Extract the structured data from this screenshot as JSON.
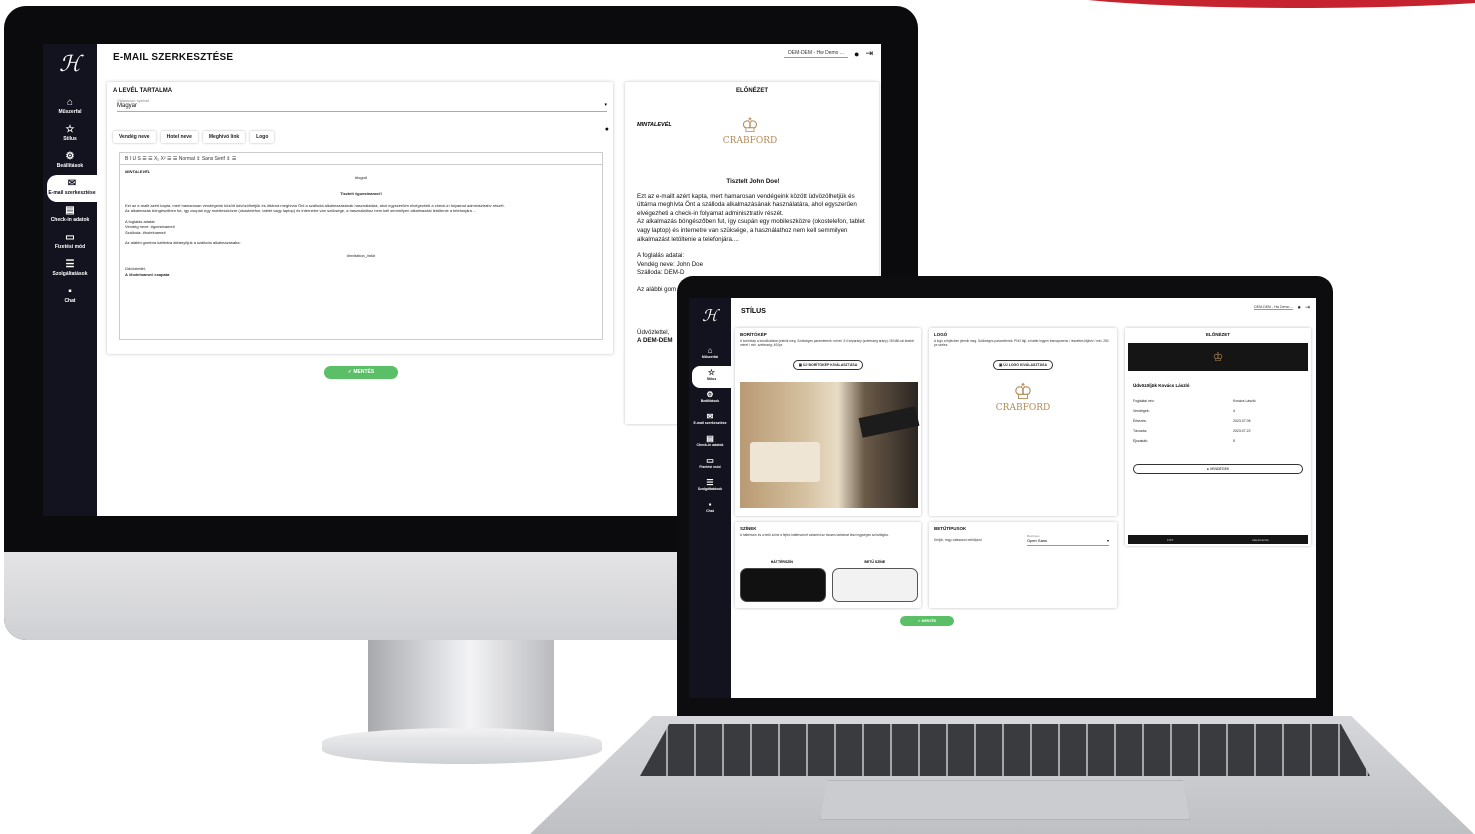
{
  "desktop": {
    "sidebar": {
      "logo": "ℋ",
      "items": [
        {
          "icon": "home-icon",
          "glyph": "⌂",
          "label": "Műszerfal"
        },
        {
          "icon": "star-icon",
          "glyph": "☆",
          "label": "Stílus"
        },
        {
          "icon": "gear-icon",
          "glyph": "⚙",
          "label": "Beállítások"
        },
        {
          "icon": "mail-icon",
          "glyph": "✉",
          "label": "E-mail szerkesztése"
        },
        {
          "icon": "document-icon",
          "glyph": "▤",
          "label": "Check-in adatok"
        },
        {
          "icon": "card-icon",
          "glyph": "▭",
          "label": "Fizetési mód"
        },
        {
          "icon": "list-icon",
          "glyph": "☰",
          "label": "Szolgáltatások"
        },
        {
          "icon": "chat-icon",
          "glyph": "▪",
          "label": "Chat"
        }
      ]
    },
    "page_title": "E-MAIL SZERKESZTÉSE",
    "hotel_select": "DEM-DEM - Hw Demo ...",
    "content_card": {
      "title": "A LEVÉL TARTALMA",
      "lang_label": "Válasszon nyelvet",
      "lang_value": "Magyar",
      "chips": [
        "Vendég neve",
        "Hotel neve",
        "Meghívó link",
        "Logo"
      ],
      "toolbar": "B  I  U  S    ☰  ☰    X₂  X²    ☰  ☰     Normal  ⇕     Sans Serif  ⇕     ☰",
      "body": {
        "l1": "MINTALEVÉL",
        "l2": "#logo#",
        "l3": "Tisztelt #guestname#!",
        "l4": "Ezt az e-mailt azért kapta, mert hamarosan vendégeink között üdvözölhetjük és üttárna meghívta Önt a szálloda alkalmazásának használatára, ahol egyszerűen elvégezheti a check-in folyamat adminisztratív részét.",
        "l5": "Az alkalmazás böngészőben fut, így csupán egy mobileszközre (okostelefon, tablet vagy laptop) és internetre van szüksége, a használathoz nem kell semmilyen alkalmazást letöltenie a telefonjára ...",
        "l6": "A foglalás adatai:",
        "l7": "Vendég neve: #guestname#",
        "l8": "Szálloda: #hotelname#",
        "l9": "Az alábbi gombra kattintva átirányítjuk a szálloda alkalmazásába:",
        "l10": "#invitation_link#",
        "l11": "Üdvözlettel,",
        "l12": "A #hotelname# csapata"
      }
    },
    "save_label": "✓  MENTÉS",
    "preview": {
      "title": "ELŐNÉZET",
      "sample": "MINTALEVÉL",
      "brand": "CRABFORD",
      "greeting": "Tisztelt John Doe!",
      "p1": "Ezt az e-mailt azért kapta, mert hamarosan vendégeink között üdvözölhetjük és üttárna meghívta Önt a szálloda alkalmazásának használatára, ahol egyszerűen elvégezheti a check-in folyamat adminisztratív részét.",
      "p2": "Az alkalmazás böngészőben fut, így csupán egy mobileszközre (okostelefon, tablet vagy laptop) és internetre van szüksége, a használathoz nem kell semmilyen alkalmazást letöltenie a telefonjára....",
      "p3": "A foglalás adatai:",
      "p4": "Vendég neve: John Doe",
      "p5": "Szálloda: DEM-D",
      "p6": "Az alábbi gom",
      "p7": "Üdvözlettel,",
      "p8": "A DEM-DEM"
    }
  },
  "laptop": {
    "page_title": "STÍLUS",
    "hotel_select": "DEM-DEM - Hw Demo ...",
    "sidebar_labels": [
      "Műszerfal",
      "Stílus",
      "Beállítások",
      "E-mail szerkesztése",
      "Check-in adatok",
      "Fizetési mód",
      "Szolgáltatások",
      "Chat"
    ],
    "cover": {
      "title": "BORÍTÓKÉP",
      "desc": "A borítókép a kezdőoldalon jelenik meg. Szükséges paraméterek: méret: 3:4 képarány (szélesség arány) / 80480-ral kisebb méret / min. szélesség: 400px",
      "button": "ÚJ BORÍTÓKÉP KIVÁLASZTÁSA"
    },
    "logo": {
      "title": "LOGÓ",
      "desc": "A logó a fejlécben jelenik meg. Szükséges paraméterek: PNG fájl, a háttér legyen transzparens / részletes fájlnév / min. 250 px széles.",
      "button": "ÚJ LOGÓ KIVÁLASZTÁSA",
      "brand": "CRABFORD"
    },
    "colors": {
      "title": "SZÍNEK",
      "desc": "A háttérszín és a betű színe a fejléc háttérszínét valamint az összes tartalmat teszi egységes színvilágba.",
      "bg_label": "HÁTTÉRSZÍN",
      "fg_label": "BETŰ SZÍNE",
      "bg_color": "#111111",
      "fg_color": "#f2f2f2"
    },
    "fonts": {
      "title": "BETŰTÍPUSOK",
      "desc": "Kérjük, hogy válasszon betűtípust",
      "field_label": "Betűtípus",
      "field_value": "Open Sans"
    },
    "preview": {
      "title": "ELŐNÉZET",
      "welcome": "Üdvözöljük Kovács László",
      "rows": [
        {
          "k": "Foglalási név:",
          "v": "Kovács László"
        },
        {
          "k": "Vendégek:",
          "v": "4"
        },
        {
          "k": "Érkezés:",
          "v": "2023.07.06"
        },
        {
          "k": "Távozás:",
          "v": "2023.07.22"
        },
        {
          "k": "Éjszakák:",
          "v": "5"
        }
      ],
      "guests_button": "VENDÉGEK",
      "footer_left": "FIZT",
      "footer_right": "Alapfunkciók"
    },
    "save_label": "✓  MENTÉS"
  }
}
